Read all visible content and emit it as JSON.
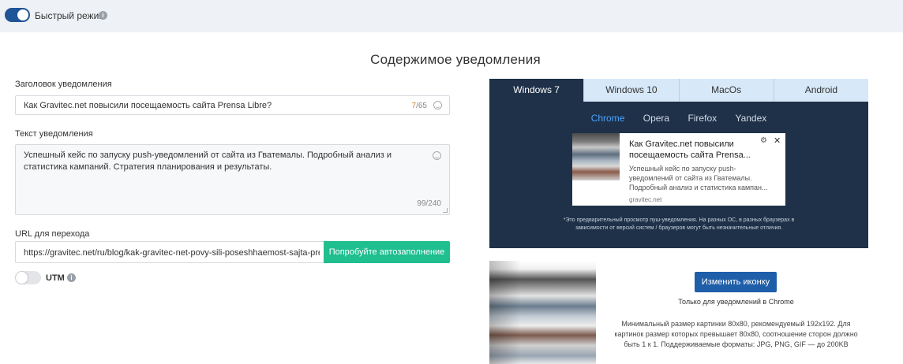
{
  "topbar": {
    "fast_mode_label": "Быстрый режим"
  },
  "section": {
    "title": "Содержимое уведомления"
  },
  "form": {
    "title_label": "Заголовок уведомления",
    "title_value": "Как Gravitec.net повысили посещаемость сайта Prensa Libre?",
    "title_counter_current": "7",
    "title_counter_total": "/65",
    "text_label": "Текст уведомления",
    "text_value": "Успешный кейс по запуску push-уведомлений от сайта из Гватемалы. Подробный анализ и статистика кампаний. Стратегия планирования и результаты.",
    "text_counter": "99/240",
    "url_label": "URL для перехода",
    "url_value": "https://gravitec.net/ru/blog/kak-gravitec-net-povy-sili-poseshhaemost-sajta-pre",
    "autofill_label": "Попробуйте автозаполнение",
    "utm_label": "UTM"
  },
  "preview": {
    "os_tabs": [
      {
        "label": "Windows 7",
        "active": true
      },
      {
        "label": "Windows 10",
        "active": false
      },
      {
        "label": "MacOs",
        "active": false
      },
      {
        "label": "Android",
        "active": false
      }
    ],
    "browser_tabs": [
      {
        "label": "Chrome",
        "active": true
      },
      {
        "label": "Opera",
        "active": false
      },
      {
        "label": "Firefox",
        "active": false
      },
      {
        "label": "Yandex",
        "active": false
      }
    ],
    "notification": {
      "title": "Как Gravitec.net повысили посещаемость сайта Prensa...",
      "body": "Успешный кейс по запуску push-уведомлений от сайта из Гватемалы. Подробный анализ и статистика кампан...",
      "site": "gravitec.net"
    },
    "note": "*Это предварительный просмотр пуш-уведомления. На разных ОС, в разных браузерах в зависимости от версий систем / браузеров могут быть незначительные отличия."
  },
  "icon_panel": {
    "change_button": "Изменить иконку",
    "chrome_only": "Только для уведомлений в Chrome",
    "requirements": "Минимальный размер картинки 80x80, рекомендуемый 192x192. Для картинок размер которых превышает 80x80, соотношение сторон должно быть 1 к 1. Поддерживаемые форматы: JPG, PNG, GIF — до 200KB"
  },
  "colors": {
    "accent_blue": "#1f5496",
    "autofill_green": "#1fbf8f",
    "preview_bg": "#1e3149",
    "active_browser": "#4ba3ff"
  }
}
